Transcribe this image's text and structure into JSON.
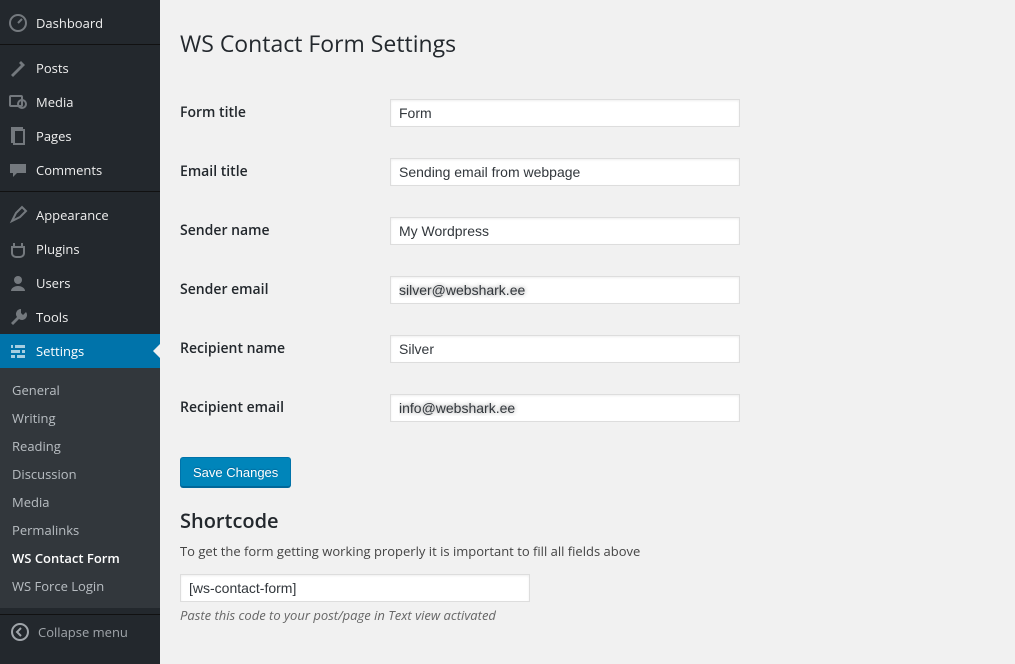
{
  "sidebar": {
    "items": [
      {
        "label": "Dashboard",
        "icon": "dashboard"
      },
      {
        "label": "Posts",
        "icon": "pin"
      },
      {
        "label": "Media",
        "icon": "media"
      },
      {
        "label": "Pages",
        "icon": "pages"
      },
      {
        "label": "Comments",
        "icon": "comments"
      },
      {
        "label": "Appearance",
        "icon": "appearance"
      },
      {
        "label": "Plugins",
        "icon": "plugins"
      },
      {
        "label": "Users",
        "icon": "users"
      },
      {
        "label": "Tools",
        "icon": "tools"
      },
      {
        "label": "Settings",
        "icon": "settings"
      }
    ],
    "submenu": [
      {
        "label": "General"
      },
      {
        "label": "Writing"
      },
      {
        "label": "Reading"
      },
      {
        "label": "Discussion"
      },
      {
        "label": "Media"
      },
      {
        "label": "Permalinks"
      },
      {
        "label": "WS Contact Form",
        "current": true
      },
      {
        "label": "WS Force Login"
      }
    ],
    "collapse_label": "Collapse menu"
  },
  "page": {
    "title": "WS Contact Form Settings",
    "fields": {
      "form_title": {
        "label": "Form title",
        "value": "Form"
      },
      "email_title": {
        "label": "Email title",
        "value": "Sending email from webpage"
      },
      "sender_name": {
        "label": "Sender name",
        "value": "My Wordpress"
      },
      "sender_email": {
        "label": "Sender email",
        "value": "silver@webshark.ee"
      },
      "recipient_name": {
        "label": "Recipient name",
        "value": "Silver"
      },
      "recipient_email": {
        "label": "Recipient email",
        "value": "info@webshark.ee"
      }
    },
    "submit_label": "Save Changes",
    "shortcode": {
      "heading": "Shortcode",
      "desc": "To get the form getting working properly it is important to fill all fields above",
      "value": "[ws-contact-form]",
      "hint": "Paste this code to your post/page in Text view activated"
    }
  }
}
